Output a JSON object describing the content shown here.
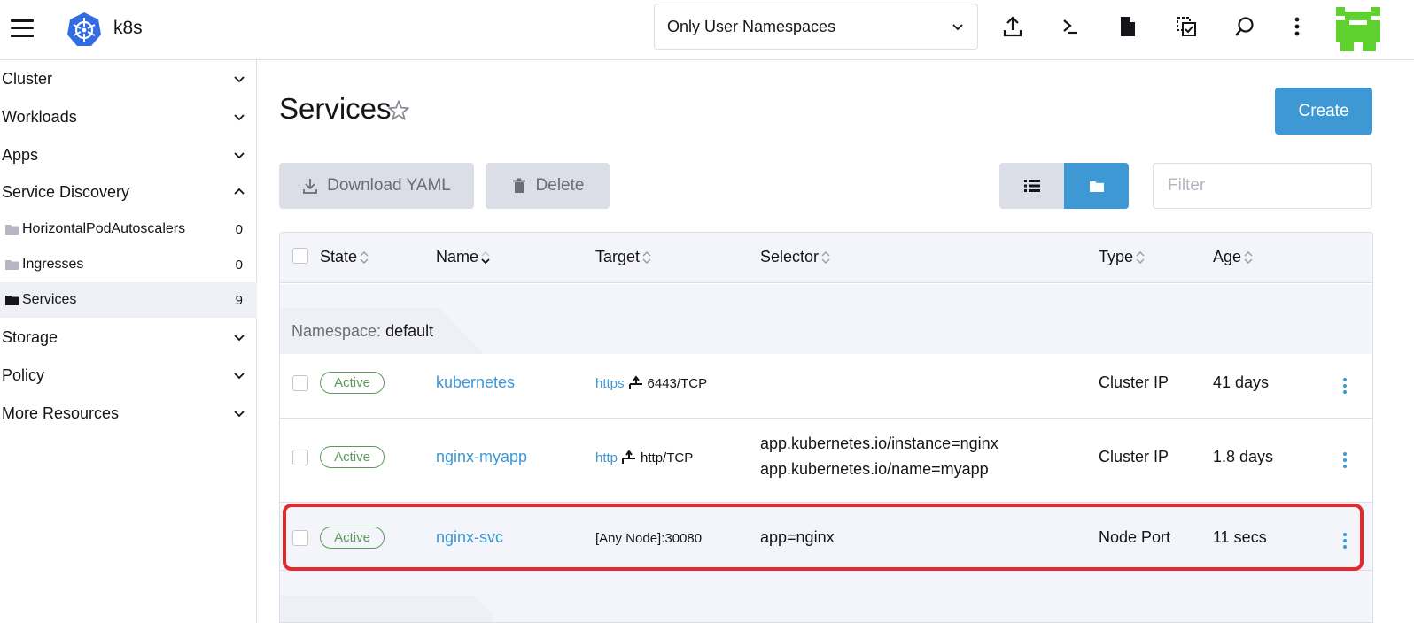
{
  "header": {
    "cluster_name": "k8s",
    "namespace_filter": "Only User Namespaces",
    "icons": [
      "import-yaml-icon",
      "kubectl-shell-icon",
      "kubeconfig-icon",
      "copy-kubeconfig-icon",
      "search-icon",
      "more-icon"
    ]
  },
  "sidebar": {
    "groups": [
      {
        "label": "Cluster",
        "expanded": false
      },
      {
        "label": "Workloads",
        "expanded": false
      },
      {
        "label": "Apps",
        "expanded": false
      },
      {
        "label": "Service Discovery",
        "expanded": true
      },
      {
        "label": "Storage",
        "expanded": false
      },
      {
        "label": "Policy",
        "expanded": false
      },
      {
        "label": "More Resources",
        "expanded": false
      }
    ],
    "service_discovery_items": [
      {
        "label": "HorizontalPodAutoscalers",
        "count": "0"
      },
      {
        "label": "Ingresses",
        "count": "0"
      },
      {
        "label": "Services",
        "count": "9",
        "active": true
      }
    ]
  },
  "page": {
    "title": "Services",
    "create_label": "Create",
    "download_label": "Download YAML",
    "delete_label": "Delete",
    "filter_placeholder": "Filter"
  },
  "table": {
    "columns": [
      "State",
      "Name",
      "Target",
      "Selector",
      "Type",
      "Age"
    ],
    "group_prefix": "Namespace:",
    "group_name": "default",
    "rows": [
      {
        "state": "Active",
        "name": "kubernetes",
        "target_proto": "https",
        "target_port": "6443/TCP",
        "selector": [],
        "type": "Cluster IP",
        "age": "41 days"
      },
      {
        "state": "Active",
        "name": "nginx-myapp",
        "target_proto": "http",
        "target_port": "http/TCP",
        "selector": [
          "app.kubernetes.io/instance=nginx",
          "app.kubernetes.io/name=myapp"
        ],
        "type": "Cluster IP",
        "age": "1.8 days"
      },
      {
        "state": "Active",
        "name": "nginx-svc",
        "target_text": "[Any Node]:30080",
        "selector": [
          "app=nginx"
        ],
        "type": "Node Port",
        "age": "11 secs",
        "highlighted": true
      }
    ]
  },
  "colors": {
    "accent": "#3d98d3",
    "active_badge": "#5d995d",
    "highlight": "#e5292a",
    "button_grey": "#dcdee7"
  }
}
